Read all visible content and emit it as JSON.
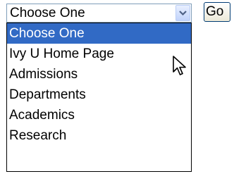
{
  "select": {
    "selected_value": "Choose One",
    "dropdown_icon": "chevron-down-icon",
    "options": [
      {
        "label": "Choose One",
        "highlighted": true
      },
      {
        "label": "Ivy U Home Page",
        "highlighted": false
      },
      {
        "label": "Admissions",
        "highlighted": false
      },
      {
        "label": "Departments",
        "highlighted": false
      },
      {
        "label": "Academics",
        "highlighted": false
      },
      {
        "label": "Research",
        "highlighted": false
      }
    ]
  },
  "go_button": {
    "label": "Go"
  },
  "colors": {
    "highlight": "#316ac5",
    "select_border": "#7f9db9",
    "list_border": "#000000"
  },
  "cursor_icon": "mouse-pointer-icon"
}
